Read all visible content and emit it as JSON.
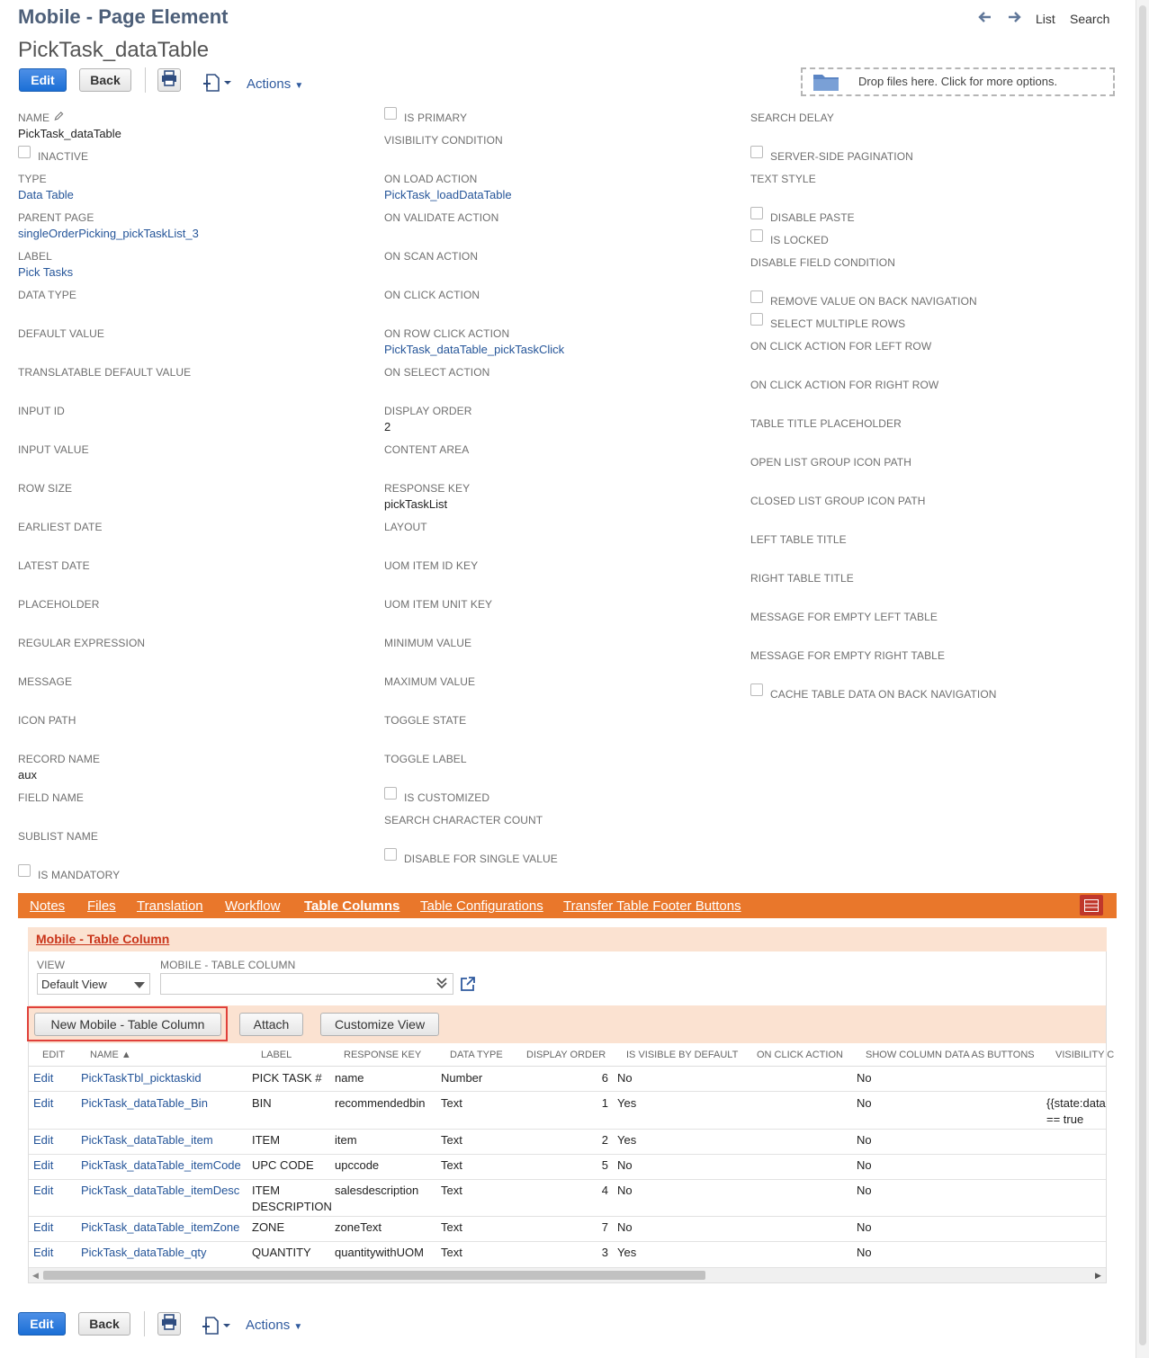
{
  "header": {
    "record_type": "Mobile - Page Element",
    "record_name": "PickTask_dataTable",
    "nav": {
      "list": "List",
      "search": "Search"
    }
  },
  "toolbar": {
    "edit": "Edit",
    "back": "Back",
    "actions": "Actions",
    "dropzone": "Drop files here. Click for more options."
  },
  "fields": {
    "name_label": "NAME",
    "name_value": "PickTask_dataTable",
    "inactive": "INACTIVE",
    "type_label": "TYPE",
    "type_value": "Data Table",
    "parent_page_label": "PARENT PAGE",
    "parent_page_value": "singleOrderPicking_pickTaskList_3",
    "label_label": "LABEL",
    "label_value": "Pick Tasks",
    "data_type": "DATA TYPE",
    "default_value": "DEFAULT VALUE",
    "translatable_default_value": "TRANSLATABLE DEFAULT VALUE",
    "input_id": "INPUT ID",
    "input_value": "INPUT VALUE",
    "row_size": "ROW SIZE",
    "earliest_date": "EARLIEST DATE",
    "latest_date": "LATEST DATE",
    "placeholder": "PLACEHOLDER",
    "regular_expression": "REGULAR EXPRESSION",
    "message": "MESSAGE",
    "icon_path": "ICON PATH",
    "record_name_label": "RECORD NAME",
    "record_name_value": "aux",
    "field_name": "FIELD NAME",
    "sublist_name": "SUBLIST NAME",
    "is_mandatory": "IS MANDATORY",
    "is_primary": "IS PRIMARY",
    "visibility_condition": "VISIBILITY CONDITION",
    "on_load_action_label": "ON LOAD ACTION",
    "on_load_action_value": "PickTask_loadDataTable",
    "on_validate_action": "ON VALIDATE ACTION",
    "on_scan_action": "ON SCAN ACTION",
    "on_click_action": "ON CLICK ACTION",
    "on_row_click_action_label": "ON ROW CLICK ACTION",
    "on_row_click_action_value": "PickTask_dataTable_pickTaskClick",
    "on_select_action": "ON SELECT ACTION",
    "display_order_label": "DISPLAY ORDER",
    "display_order_value": "2",
    "content_area": "CONTENT AREA",
    "response_key_label": "RESPONSE KEY",
    "response_key_value": "pickTaskList",
    "layout": "LAYOUT",
    "uom_item_id_key": "UOM ITEM ID KEY",
    "uom_item_unit_key": "UOM ITEM UNIT KEY",
    "minimum_value": "MINIMUM VALUE",
    "maximum_value": "MAXIMUM VALUE",
    "toggle_state": "TOGGLE STATE",
    "toggle_label": "TOGGLE LABEL",
    "is_customized": "IS CUSTOMIZED",
    "search_character_count": "SEARCH CHARACTER COUNT",
    "disable_for_single_value": "DISABLE FOR SINGLE VALUE",
    "search_delay": "SEARCH DELAY",
    "server_side_pagination": "SERVER-SIDE PAGINATION",
    "text_style": "TEXT STYLE",
    "disable_paste": "DISABLE PASTE",
    "is_locked": "IS LOCKED",
    "disable_field_condition": "DISABLE FIELD CONDITION",
    "remove_value_on_back_navigation": "REMOVE VALUE ON BACK NAVIGATION",
    "select_multiple_rows": "SELECT MULTIPLE ROWS",
    "on_click_action_for_left_row": "ON CLICK ACTION FOR LEFT ROW",
    "on_click_action_for_right_row": "ON CLICK ACTION FOR RIGHT ROW",
    "table_title_placeholder": "TABLE TITLE PLACEHOLDER",
    "open_list_group_icon_path": "OPEN LIST GROUP ICON PATH",
    "closed_list_group_icon_path": "CLOSED LIST GROUP ICON PATH",
    "left_table_title": "LEFT TABLE TITLE",
    "right_table_title": "RIGHT TABLE TITLE",
    "message_for_empty_left_table": "MESSAGE FOR EMPTY LEFT TABLE",
    "message_for_empty_right_table": "MESSAGE FOR EMPTY RIGHT TABLE",
    "cache_table_data_on_back_navigation": "CACHE TABLE DATA ON BACK NAVIGATION"
  },
  "tabs": [
    "Notes",
    "Files",
    "Translation",
    "Workflow",
    "Table Columns",
    "Table Configurations",
    "Transfer Table Footer Buttons"
  ],
  "active_tab": "Table Columns",
  "sublist": {
    "title": "Mobile - Table Column",
    "view_label": "VIEW",
    "view_value": "Default View",
    "column_select_label": "MOBILE - TABLE COLUMN",
    "new_button": "New Mobile - Table Column",
    "attach_button": "Attach",
    "customize_button": "Customize View",
    "columns": [
      "EDIT",
      "NAME ▲",
      "LABEL",
      "RESPONSE KEY",
      "DATA TYPE",
      "DISPLAY ORDER",
      "IS VISIBLE BY DEFAULT",
      "ON CLICK ACTION",
      "SHOW COLUMN DATA AS BUTTONS",
      "VISIBILITY C"
    ],
    "rows": [
      {
        "edit": "Edit",
        "name": "PickTaskTbl_picktaskid",
        "label": "PICK TASK #",
        "label2": "",
        "response_key": "name",
        "data_type": "Number",
        "display_order": "6",
        "visible": "No",
        "buttons": "No",
        "visibility": "",
        "visibility2": ""
      },
      {
        "edit": "Edit",
        "name": "PickTask_dataTable_Bin",
        "label": "BIN",
        "label2": "",
        "response_key": "recommendedbin",
        "data_type": "Text",
        "display_order": "1",
        "visible": "Yes",
        "buttons": "No",
        "visibility": "{{state:data",
        "visibility2": "== true"
      },
      {
        "edit": "Edit",
        "name": "PickTask_dataTable_item",
        "label": "ITEM",
        "label2": "",
        "response_key": "item",
        "data_type": "Text",
        "display_order": "2",
        "visible": "Yes",
        "buttons": "No",
        "visibility": "",
        "visibility2": ""
      },
      {
        "edit": "Edit",
        "name": "PickTask_dataTable_itemCode",
        "label": "UPC CODE",
        "label2": "",
        "response_key": "upccode",
        "data_type": "Text",
        "display_order": "5",
        "visible": "No",
        "buttons": "No",
        "visibility": "",
        "visibility2": ""
      },
      {
        "edit": "Edit",
        "name": "PickTask_dataTable_itemDesc",
        "label": "ITEM",
        "label2": "DESCRIPTION",
        "response_key": "salesdescription",
        "data_type": "Text",
        "display_order": "4",
        "visible": "No",
        "buttons": "No",
        "visibility": "",
        "visibility2": ""
      },
      {
        "edit": "Edit",
        "name": "PickTask_dataTable_itemZone",
        "label": "ZONE",
        "label2": "",
        "response_key": "zoneText",
        "data_type": "Text",
        "display_order": "7",
        "visible": "No",
        "buttons": "No",
        "visibility": "",
        "visibility2": ""
      },
      {
        "edit": "Edit",
        "name": "PickTask_dataTable_qty",
        "label": "QUANTITY",
        "label2": "",
        "response_key": "quantitywithUOM",
        "data_type": "Text",
        "display_order": "3",
        "visible": "Yes",
        "buttons": "No",
        "visibility": "",
        "visibility2": ""
      }
    ]
  }
}
